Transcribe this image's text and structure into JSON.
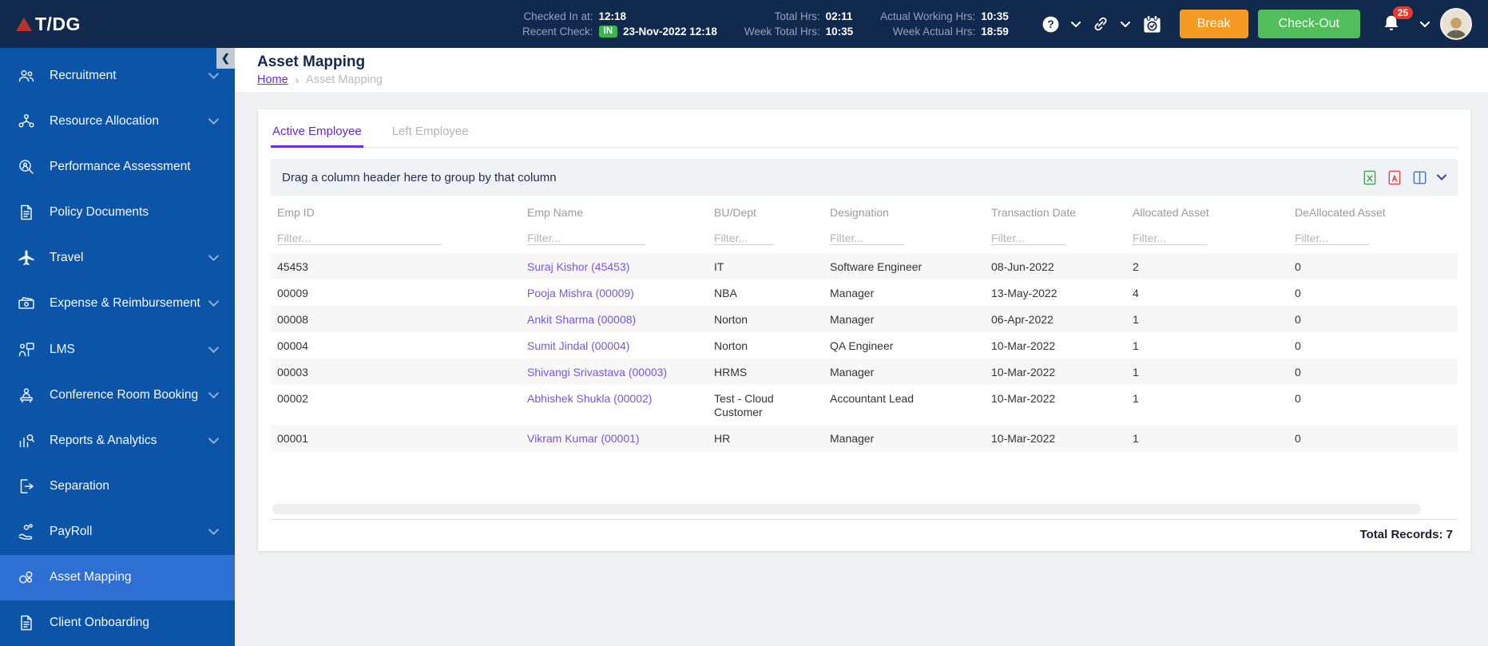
{
  "topbar": {
    "logo_text": "T/DG",
    "checked_in_label": "Checked In at:",
    "checked_in_value": "12:18",
    "recent_check_label": "Recent Check:",
    "recent_check_badge": "IN",
    "recent_check_value": "23-Nov-2022 12:18",
    "total_hrs_label": "Total Hrs:",
    "total_hrs_value": "02:11",
    "week_total_hrs_label": "Week Total Hrs:",
    "week_total_hrs_value": "10:35",
    "actual_working_hrs_label": "Actual Working Hrs:",
    "actual_working_hrs_value": "10:35",
    "week_actual_hrs_label": "Week Actual Hrs:",
    "week_actual_hrs_value": "18:59",
    "break_button_label": "Break",
    "checkout_button_label": "Check-Out",
    "notification_count": "25"
  },
  "sidebar": {
    "items": [
      {
        "label": "Recruitment",
        "icon": "recruitment-people-icon",
        "expandable": true,
        "active": false
      },
      {
        "label": "Resource Allocation",
        "icon": "resource-allocation-icon",
        "expandable": true,
        "active": false
      },
      {
        "label": "Performance Assessment",
        "icon": "performance-magnifier-icon",
        "expandable": false,
        "active": false
      },
      {
        "label": "Policy Documents",
        "icon": "document-icon",
        "expandable": false,
        "active": false
      },
      {
        "label": "Travel",
        "icon": "plane-icon",
        "expandable": true,
        "active": false
      },
      {
        "label": "Expense & Reimbursement",
        "icon": "money-icon",
        "expandable": true,
        "active": false
      },
      {
        "label": "LMS",
        "icon": "training-icon",
        "expandable": true,
        "active": false
      },
      {
        "label": "Conference Room Booking",
        "icon": "conference-icon",
        "expandable": true,
        "active": false
      },
      {
        "label": "Reports & Analytics",
        "icon": "chart-magnifier-icon",
        "expandable": true,
        "active": false
      },
      {
        "label": "Separation",
        "icon": "exit-door-icon",
        "expandable": false,
        "active": false
      },
      {
        "label": "PayRoll",
        "icon": "hand-coin-icon",
        "expandable": true,
        "active": false
      },
      {
        "label": "Asset Mapping",
        "icon": "linked-assets-icon",
        "expandable": false,
        "active": true
      },
      {
        "label": "Client Onboarding",
        "icon": "document-icon",
        "expandable": false,
        "active": false
      }
    ]
  },
  "page": {
    "title": "Asset Mapping",
    "breadcrumb_home": "Home",
    "breadcrumb_separator": "›",
    "breadcrumb_current": "Asset Mapping"
  },
  "tabs": {
    "active_label": "Active Employee",
    "inactive_label": "Left Employee"
  },
  "grid": {
    "group_panel_text": "Drag a column header here to group by that column",
    "toolbar_icons": [
      "excel-export-icon",
      "pdf-export-icon",
      "column-chooser-icon",
      "chevron-down-icon"
    ],
    "columns": [
      "Emp ID",
      "Emp Name",
      "BU/Dept",
      "Designation",
      "Transaction Date",
      "Allocated Asset",
      "DeAllocated Asset"
    ],
    "filter_placeholder": "Filter...",
    "rows": [
      {
        "emp_id": "45453",
        "emp_name": "Suraj Kishor (45453)",
        "bu_dept": "IT",
        "designation": "Software Engineer",
        "transaction_date": "08-Jun-2022",
        "allocated": "2",
        "deallocated": "0"
      },
      {
        "emp_id": "00009",
        "emp_name": "Pooja Mishra (00009)",
        "bu_dept": "NBA",
        "designation": "Manager",
        "transaction_date": "13-May-2022",
        "allocated": "4",
        "deallocated": "0"
      },
      {
        "emp_id": "00008",
        "emp_name": "Ankit Sharma (00008)",
        "bu_dept": "Norton",
        "designation": "Manager",
        "transaction_date": "06-Apr-2022",
        "allocated": "1",
        "deallocated": "0"
      },
      {
        "emp_id": "00004",
        "emp_name": "Sumit Jindal (00004)",
        "bu_dept": "Norton",
        "designation": "QA Engineer",
        "transaction_date": "10-Mar-2022",
        "allocated": "1",
        "deallocated": "0"
      },
      {
        "emp_id": "00003",
        "emp_name": "Shivangi Srivastava (00003)",
        "bu_dept": "HRMS",
        "designation": "Manager",
        "transaction_date": "10-Mar-2022",
        "allocated": "1",
        "deallocated": "0"
      },
      {
        "emp_id": "00002",
        "emp_name": "Abhishek Shukla (00002)",
        "bu_dept": "Test - Cloud Customer",
        "designation": "Accountant Lead",
        "transaction_date": "10-Mar-2022",
        "allocated": "1",
        "deallocated": "0"
      },
      {
        "emp_id": "00001",
        "emp_name": "Vikram Kumar (00001)",
        "bu_dept": "HR",
        "designation": "Manager",
        "transaction_date": "10-Mar-2022",
        "allocated": "1",
        "deallocated": "0"
      }
    ],
    "total_records_label": "Total Records:",
    "total_records_value": "7"
  },
  "colors": {
    "topbar_bg": "#12294E",
    "sidebar_bg": "#0B54A8",
    "sidebar_active_bg": "#2D6FD2",
    "accent_purple": "#6429CF",
    "link_purple": "#7A55D8",
    "break_orange": "#F59B23",
    "checkout_green": "#52BE5B",
    "in_badge_green": "#3CB54E",
    "notification_red": "#E8392E",
    "logo_red": "#B5342C",
    "page_bg": "#EEF0F2",
    "group_panel_bg": "#EFF3F6"
  }
}
